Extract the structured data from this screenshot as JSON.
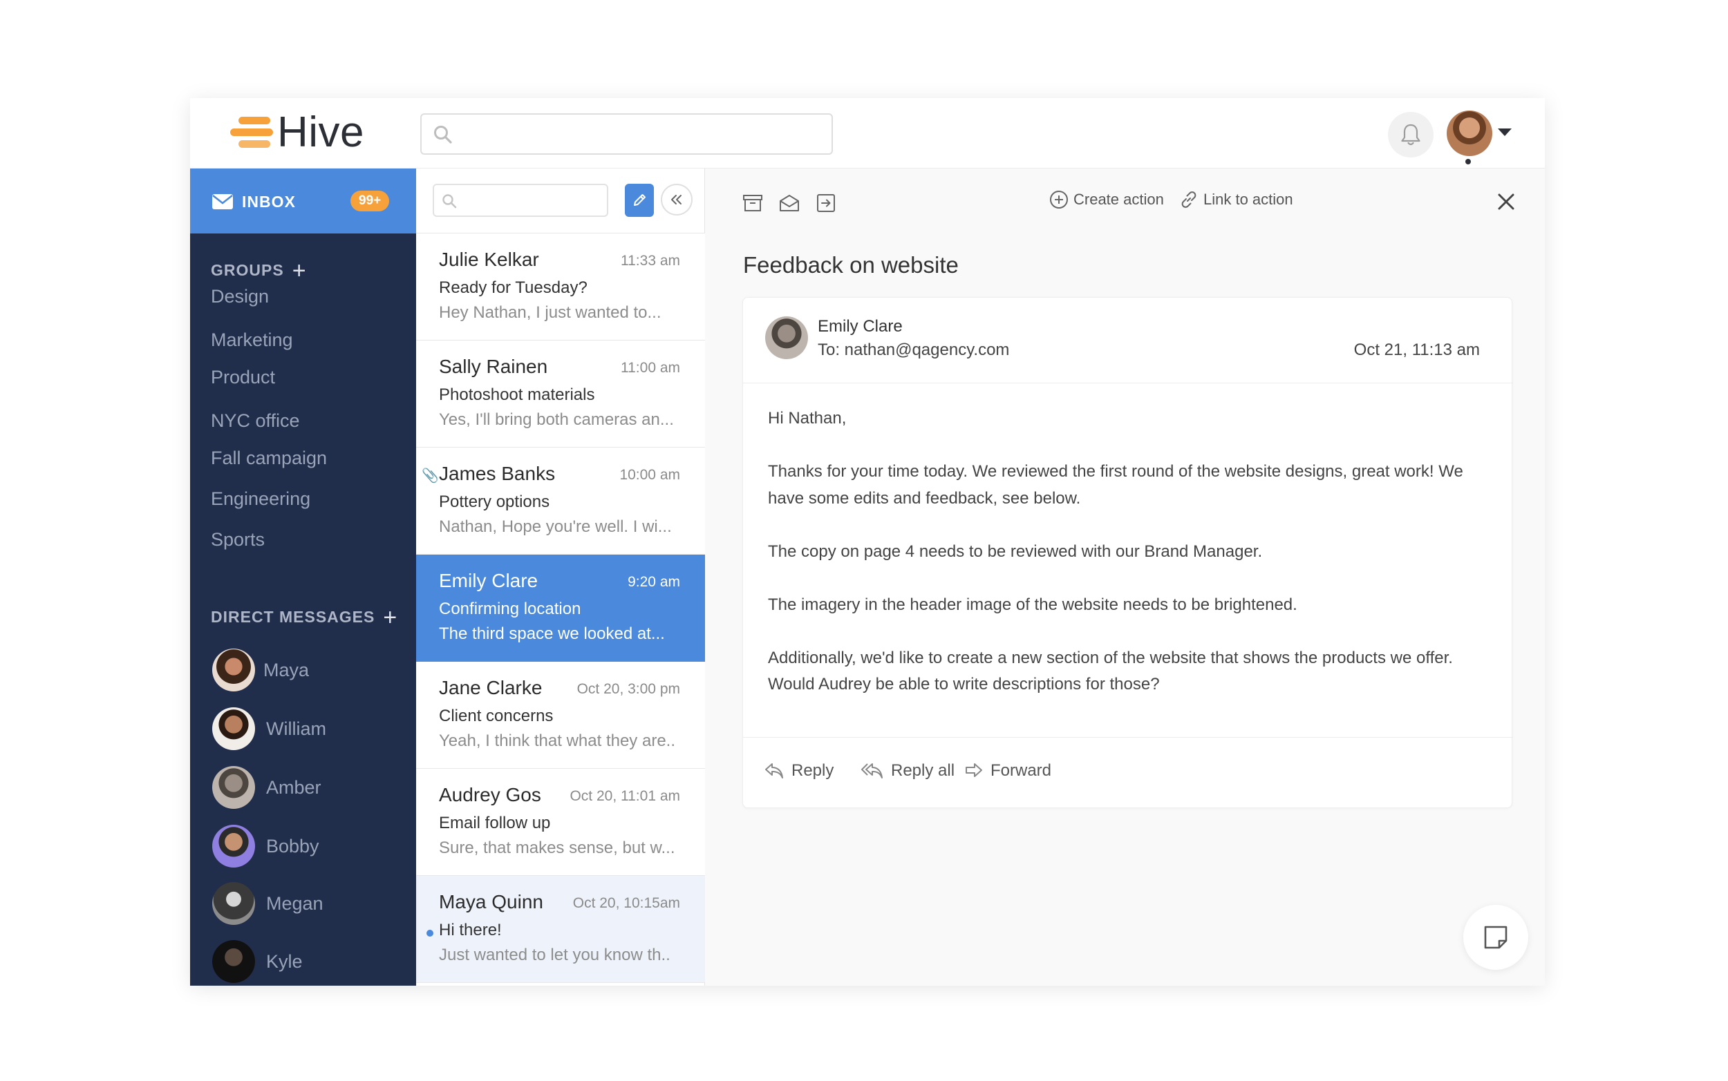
{
  "app": {
    "logo_text": "Hive"
  },
  "header": {
    "search_placeholder": ""
  },
  "sidebar": {
    "inbox": {
      "label": "INBOX",
      "badge": "99+"
    },
    "groups_title": "GROUPS",
    "groups": [
      "Design",
      "Marketing",
      "Product",
      "NYC office",
      "Fall campaign",
      "Engineering",
      "Sports"
    ],
    "dm_title": "DIRECT MESSAGES",
    "direct_messages": [
      "Maya",
      "William",
      "Amber",
      "Bobby",
      "Megan",
      "Kyle"
    ]
  },
  "messages": [
    {
      "sender": "Julie Kelkar",
      "time": "11:33 am",
      "subject": "Ready for Tuesday?",
      "preview": "Hey Nathan, I just wanted to..."
    },
    {
      "sender": "Sally Rainen",
      "time": "11:00 am",
      "subject": "Photoshoot materials",
      "preview": "Yes, I'll bring both cameras an..."
    },
    {
      "sender": "James Banks",
      "time": "10:00 am",
      "subject": "Pottery options",
      "preview": "Nathan, Hope you're well. I wi..."
    },
    {
      "sender": "Emily Clare",
      "time": "9:20 am",
      "subject": "Confirming location",
      "preview": "The third space we looked at..."
    },
    {
      "sender": "Jane Clarke",
      "time": "Oct 20, 3:00 pm",
      "subject": "Client concerns",
      "preview": "Yeah, I think that what they are.."
    },
    {
      "sender": "Audrey Gos",
      "time": "Oct 20, 11:01 am",
      "subject": "Email follow up",
      "preview": "Sure, that makes sense, but w..."
    },
    {
      "sender": "Maya Quinn",
      "time": "Oct 20, 10:15am",
      "subject": "Hi there!",
      "preview": "Just wanted to let you know th.."
    }
  ],
  "pane": {
    "toolbar": {
      "create_action": "Create action",
      "link_action": "Link to action"
    },
    "title": "Feedback on website",
    "email": {
      "from": "Emily Clare",
      "to": "To: nathan@qagency.com",
      "date": "Oct 21, 11:13 am",
      "greeting": "Hi Nathan,",
      "p1": "Thanks for your time today. We reviewed the first round of the website designs, great work! We have some edits and feedback, see below.",
      "p2": "The copy on page 4 needs to be reviewed with our Brand Manager.",
      "p3": "The imagery in the header image of the website needs to be brightened.",
      "p4": "Additionally, we'd like to create a new section of the website that shows the products we offer. Would Audrey be able to write descriptions for those?"
    },
    "actions": {
      "reply": "Reply",
      "reply_all": "Reply all",
      "forward": "Forward"
    }
  },
  "colors": {
    "sidebar": "#202d4b",
    "accent": "#4a89dc",
    "brand": "#f6a13a"
  }
}
